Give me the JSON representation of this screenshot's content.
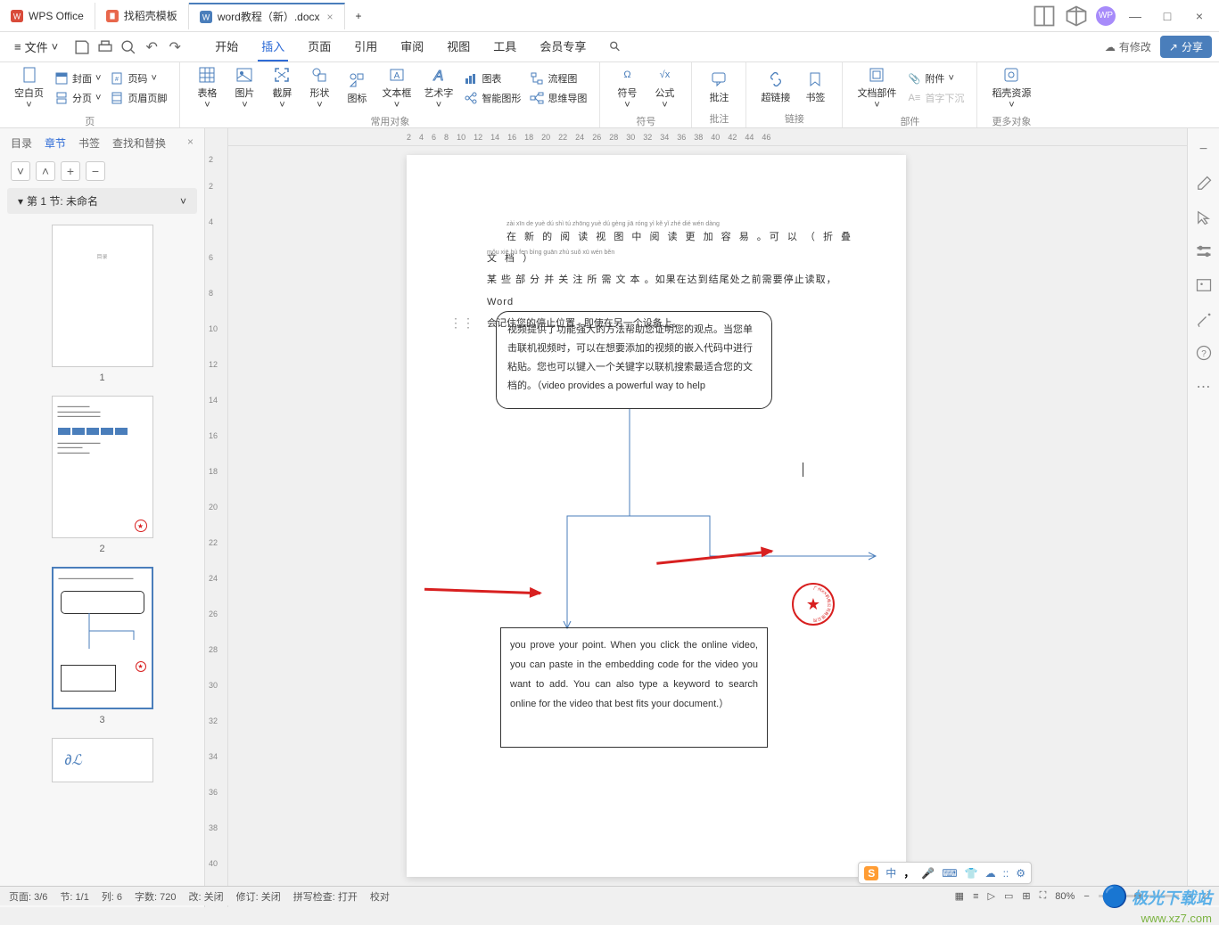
{
  "tabs": [
    {
      "label": "WPS Office",
      "icon": "wps"
    },
    {
      "label": "找稻壳模板",
      "icon": "dao"
    },
    {
      "label": "word教程（新）.docx",
      "icon": "word",
      "active": true
    }
  ],
  "window": {
    "avatar": "WP"
  },
  "menubar": {
    "file": "文件",
    "tabs": [
      "开始",
      "插入",
      "页面",
      "引用",
      "审阅",
      "视图",
      "工具",
      "会员专享"
    ],
    "active": "插入",
    "changes": "有修改",
    "share": "分享"
  },
  "ribbon": {
    "groups": [
      {
        "label": "页",
        "items": [
          {
            "label": "空白页",
            "icon": "blank-page"
          },
          {
            "sub": [
              {
                "label": "封面",
                "icon": "cover"
              },
              {
                "label": "分页",
                "icon": "pagebreak"
              },
              {
                "label": "页码",
                "icon": "pagenum"
              },
              {
                "label": "页眉页脚",
                "icon": "headerfooter"
              }
            ]
          }
        ]
      },
      {
        "label": "常用对象",
        "items": [
          {
            "label": "表格",
            "icon": "table"
          },
          {
            "label": "图片",
            "icon": "picture"
          },
          {
            "label": "截屏",
            "icon": "screenshot"
          },
          {
            "label": "形状",
            "icon": "shapes"
          },
          {
            "label": "图标",
            "icon": "icons"
          },
          {
            "label": "文本框",
            "icon": "textbox"
          },
          {
            "label": "艺术字",
            "icon": "wordart"
          },
          {
            "sub": [
              {
                "label": "图表",
                "icon": "chart"
              },
              {
                "label": "智能图形",
                "icon": "smartart"
              },
              {
                "label": "流程图",
                "icon": "flowchart"
              },
              {
                "label": "思维导图",
                "icon": "mindmap"
              }
            ]
          }
        ]
      },
      {
        "label": "符号",
        "items": [
          {
            "label": "符号",
            "icon": "symbol"
          },
          {
            "label": "公式",
            "icon": "equation"
          }
        ]
      },
      {
        "label": "批注",
        "items": [
          {
            "label": "批注",
            "icon": "comment"
          }
        ]
      },
      {
        "label": "链接",
        "items": [
          {
            "label": "超链接",
            "icon": "hyperlink"
          },
          {
            "label": "书签",
            "icon": "bookmark"
          }
        ]
      },
      {
        "label": "部件",
        "items": [
          {
            "label": "文档部件",
            "icon": "parts"
          },
          {
            "sub": [
              {
                "label": "附件",
                "icon": "attachment"
              },
              {
                "label": "首字下沉",
                "icon": "dropcap",
                "disabled": true
              }
            ]
          }
        ]
      },
      {
        "label": "更多对象",
        "items": [
          {
            "label": "稻壳资源",
            "icon": "resource"
          }
        ]
      }
    ]
  },
  "sidebar": {
    "tabs": [
      "目录",
      "章节",
      "书签",
      "查找和替换"
    ],
    "active": "章节",
    "section": "第 1 节: 未命名",
    "thumbs": [
      1,
      2,
      3
    ],
    "selected": 3
  },
  "ruler": {
    "h": [
      "2",
      "4",
      "6",
      "8",
      "10",
      "12",
      "14",
      "16",
      "18",
      "20",
      "22",
      "24",
      "26",
      "28",
      "30",
      "32",
      "34",
      "36",
      "38",
      "40",
      "42",
      "44",
      "46"
    ],
    "v": [
      "2",
      "2",
      "4",
      "6",
      "8",
      "10",
      "12",
      "14",
      "16",
      "18",
      "20",
      "22",
      "24",
      "26",
      "28",
      "30",
      "32",
      "34",
      "36",
      "38",
      "40"
    ]
  },
  "document": {
    "para_pinyin1": "zài xīn de yuè dú shì tú zhōng yuè dú gèng jiā róng yì    kě yǐ    zhé dié wén dàng",
    "para1": "在 新 的 阅 读 视 图 中 阅 读 更 加 容 易 。可 以 （ 折 叠 文 档 ）",
    "para_pinyin2": "mǒu xiē bù fen bìng guān zhù suǒ xū wén běn",
    "para2": "某 些 部 分 并 关 注 所 需 文 本 。如果在达到结尾处之前需要停止读取，Word",
    "para3": "会记住您的停止位置 - 即使在另一个设备上。",
    "box1": "视频提供了功能强大的方法帮助您证明您的观点。当您单击联机视频时，可以在想要添加的视频的嵌入代码中进行粘贴。您也可以键入一个关键字以联机搜索最适合您的文档的。（video provides a powerful way to help",
    "box2": "you prove your point. When you click the online video, you can paste in the embedding code for the video you want to add. You can also type a keyword to search online for the video that best fits your document.）"
  },
  "ime": {
    "items": [
      "中",
      "，",
      "🎤",
      "⌨",
      "👕",
      "☁",
      "::",
      "⚙"
    ]
  },
  "status": {
    "page": "页面: 3/6",
    "section": "节: 1/1",
    "col": "列: 6",
    "words": "字数: 720",
    "track": "改: 关闭",
    "rev": "修订: 关闭",
    "spell": "拼写检查: 打开",
    "proof": "校对",
    "zoom": "80%"
  },
  "watermark": {
    "name": "极光下载站",
    "url": "www.xz7.com"
  }
}
